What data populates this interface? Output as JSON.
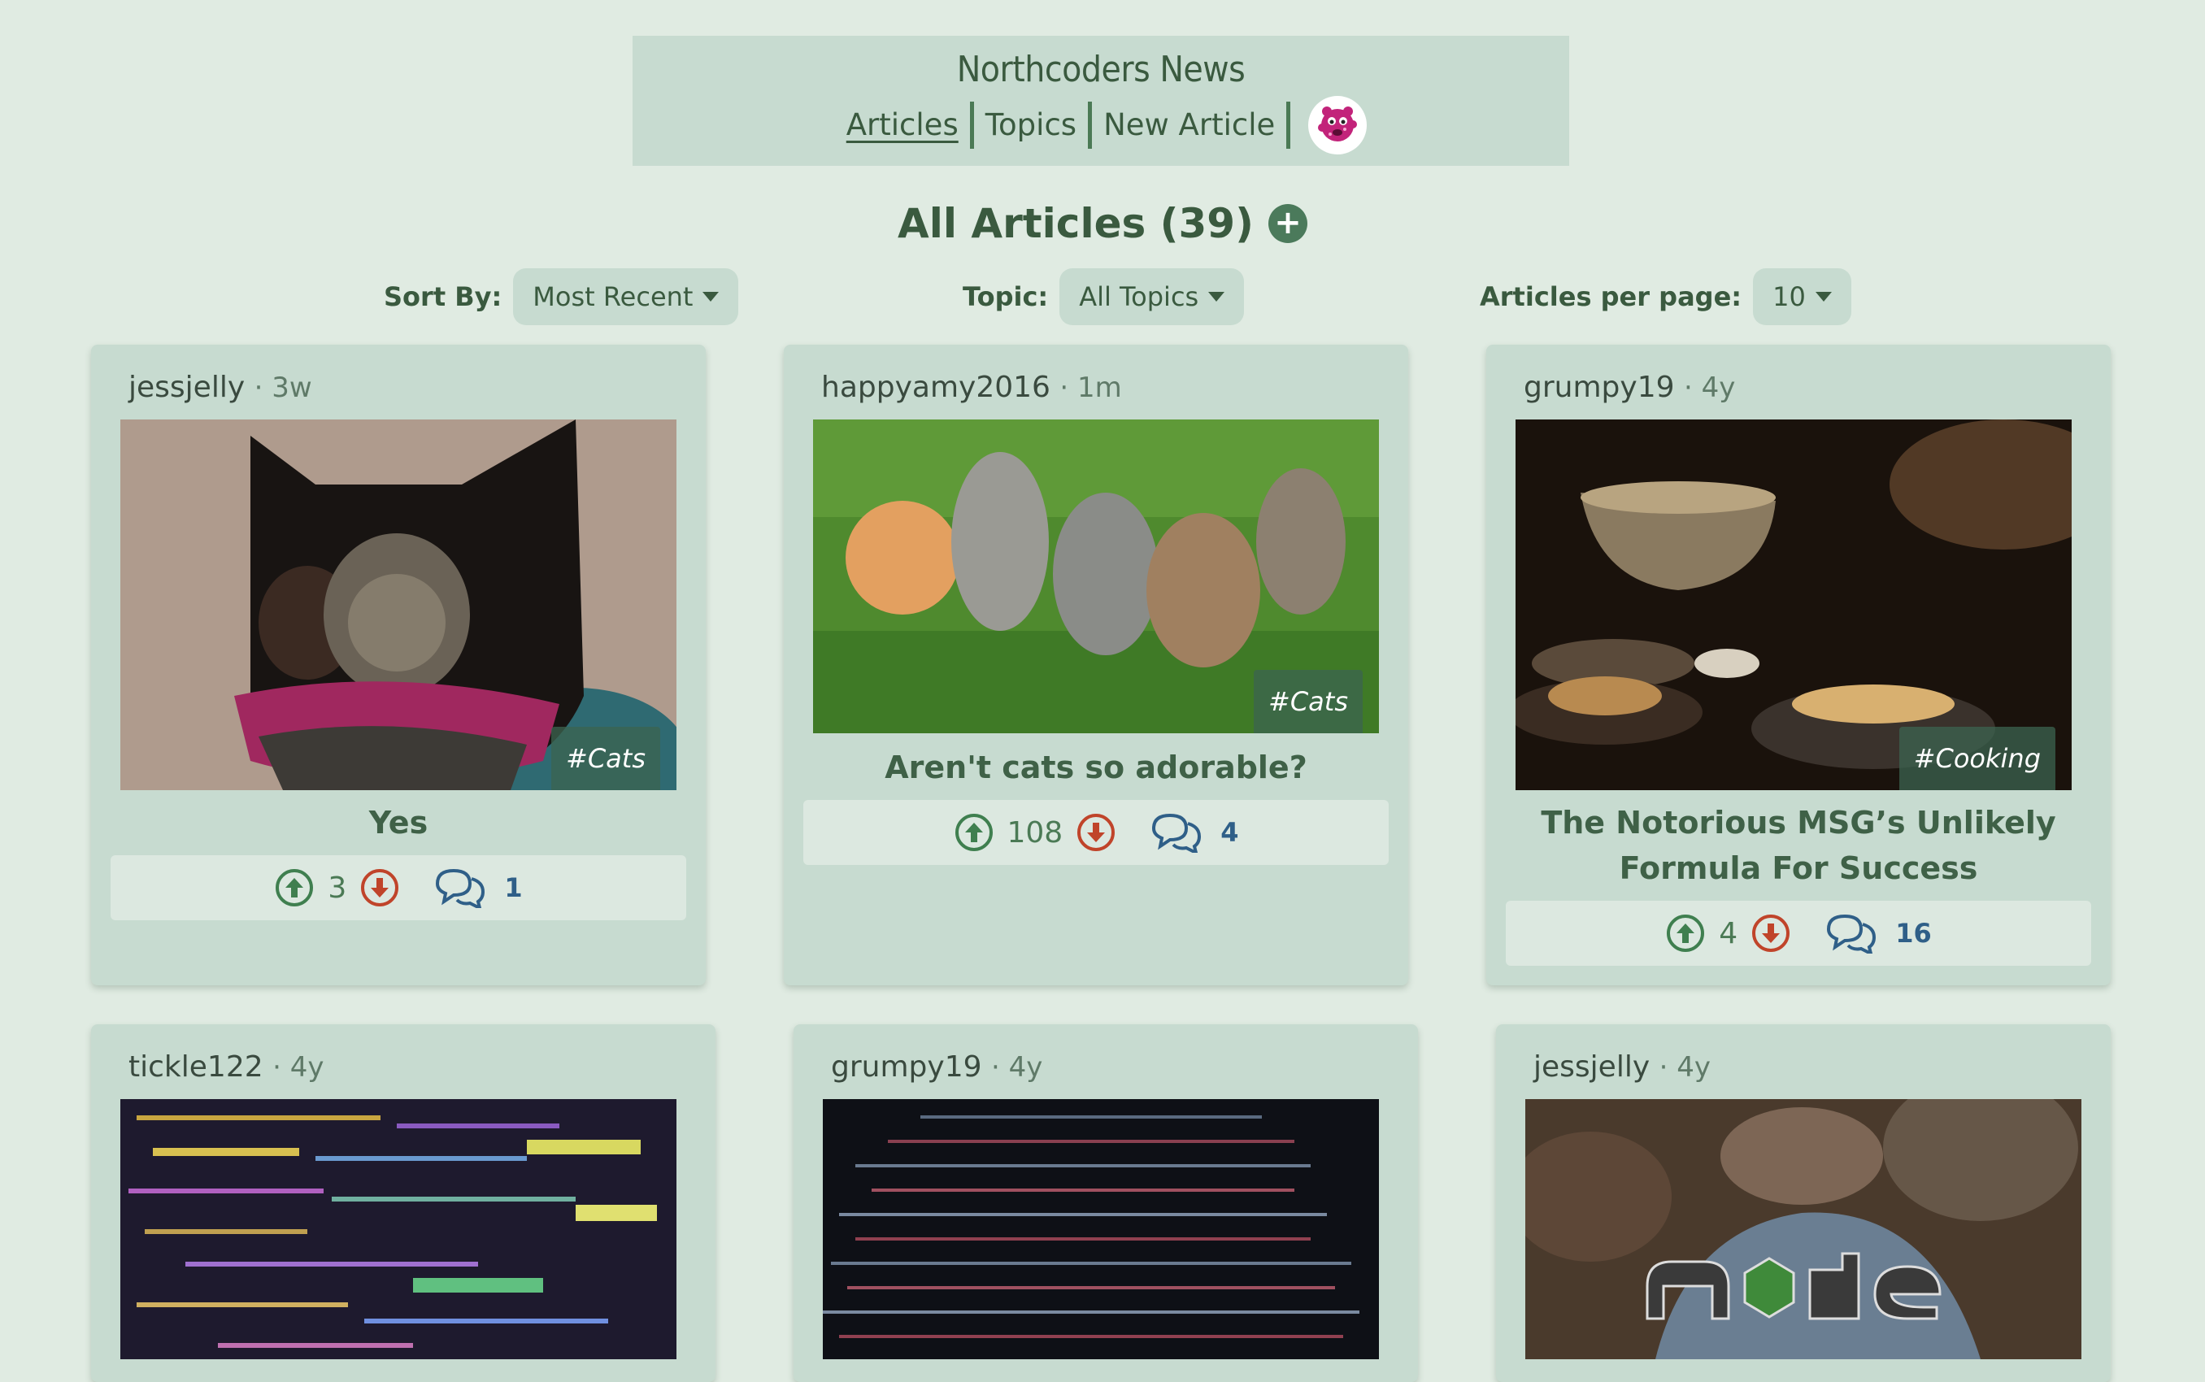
{
  "header": {
    "site_title": "Northcoders News",
    "nav": [
      "Articles",
      "Topics",
      "New Article"
    ],
    "avatar_icon": "pink-monster-avatar-icon"
  },
  "page": {
    "title": "All Articles (39)",
    "add_icon": "plus-icon"
  },
  "controls": {
    "sort_label": "Sort By:",
    "sort_value": "Most Recent",
    "topic_label": "Topic:",
    "topic_value": "All Topics",
    "per_page_label": "Articles per page:",
    "per_page_value": "10"
  },
  "articles": [
    {
      "author": "jessjelly",
      "age": "· 3w",
      "topic": "#Cats",
      "title": "Yes",
      "votes": "3",
      "comments": "1"
    },
    {
      "author": "happyamy2016",
      "age": "· 1m",
      "topic": "#Cats",
      "title": "Aren't cats so adorable?",
      "votes": "108",
      "comments": "4"
    },
    {
      "author": "grumpy19",
      "age": "· 4y",
      "topic": "#Cooking",
      "title_line1": "The Notorious MSG’s Unlikely",
      "title_line2": "Formula For Success",
      "votes": "4",
      "comments": "16"
    },
    {
      "author": "tickle122",
      "age": "· 4y"
    },
    {
      "author": "grumpy19",
      "age": "· 4y"
    },
    {
      "author": "jessjelly",
      "age": "· 4y"
    }
  ],
  "colors": {
    "background": "#e0ebe2",
    "card": "#c7dbd0",
    "upvote": "#3f7f4f",
    "downvote": "#c0442a",
    "comment": "#2f5f88"
  }
}
